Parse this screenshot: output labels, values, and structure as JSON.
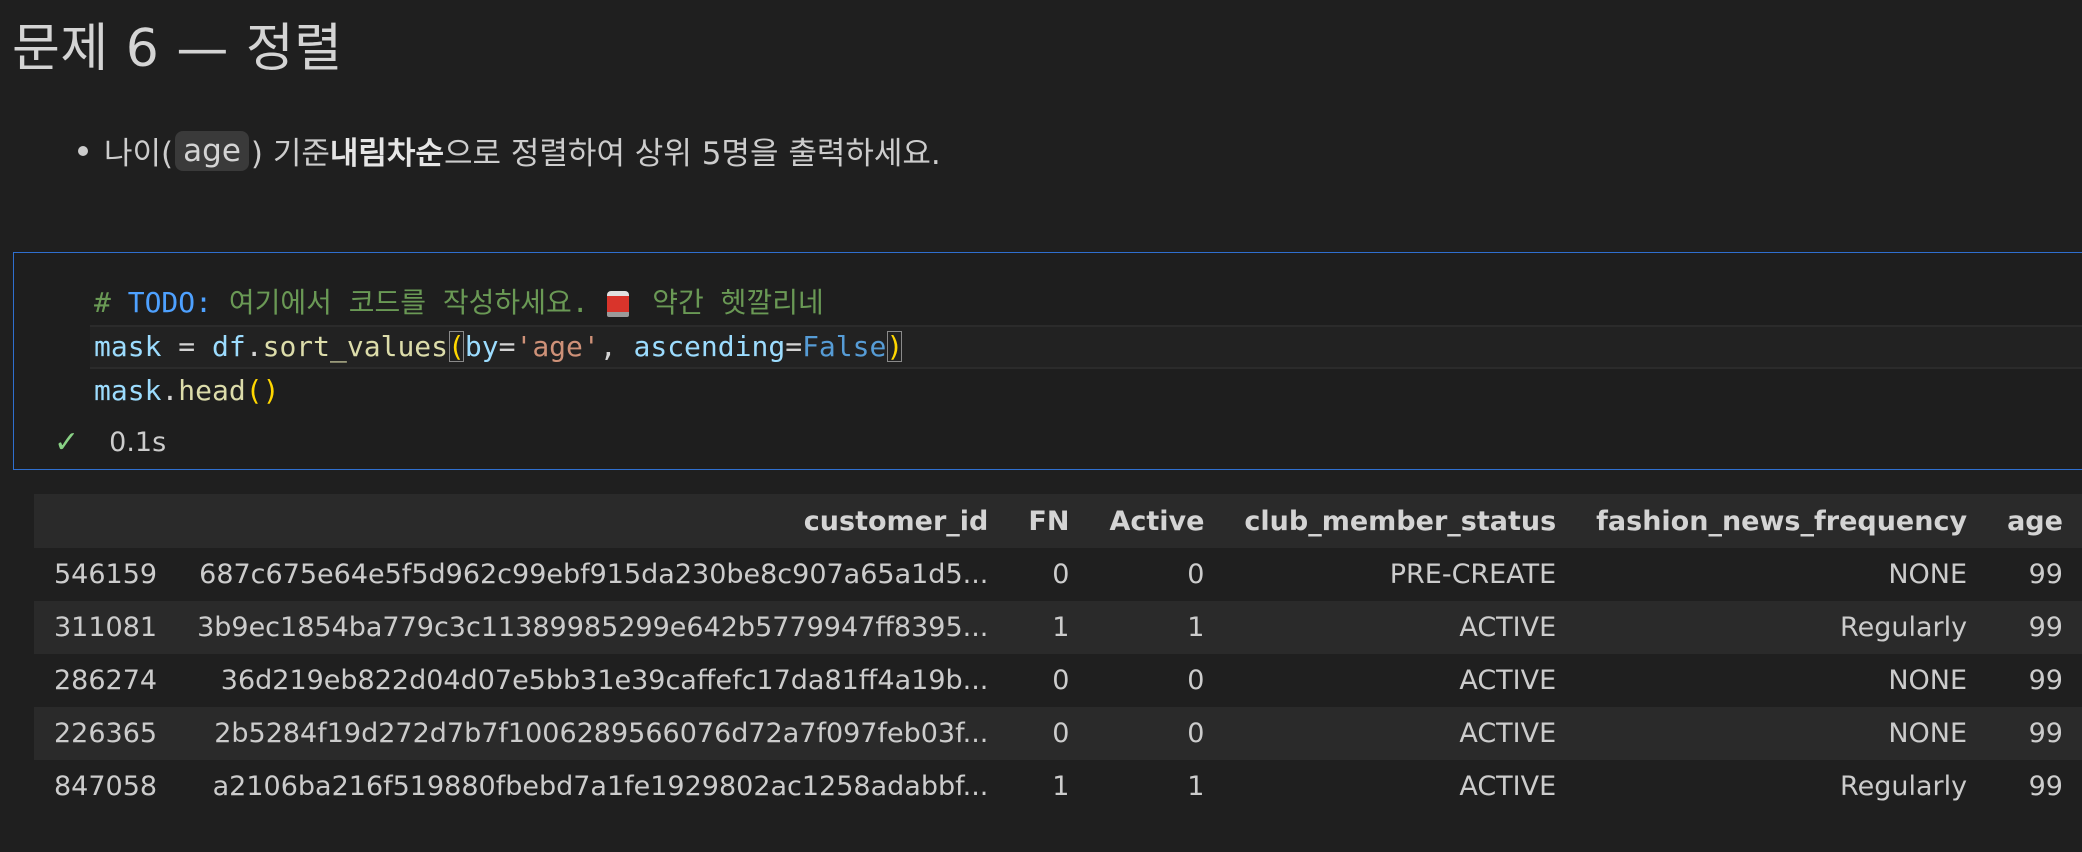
{
  "heading": "문제 6 — 정렬",
  "instruction": {
    "prefix": "나이(",
    "code": "age",
    "middle": ") 기준 ",
    "bold": "내림차순",
    "suffix": "으로 정렬하여 상위 5명을 출력하세요."
  },
  "code": {
    "comment_hash": "# ",
    "comment_todo": "TODO:",
    "comment_text": " 여기에서 코드를 작성하세요. ",
    "comment_tail": " 약간 헷깔리네",
    "line2": {
      "var": "mask",
      "eq": " = ",
      "obj": "df",
      "dot": ".",
      "func": "sort_values",
      "lparen": "(",
      "arg1": "by",
      "eq1": "=",
      "str1": "'age'",
      "comma": ", ",
      "arg2": "ascending",
      "eq2": "=",
      "kw": "False",
      "rparen": ")"
    },
    "line3": {
      "var": "mask",
      "dot": ".",
      "func": "head",
      "parens": "()"
    }
  },
  "execution": {
    "time": "0.1s"
  },
  "table": {
    "columns": [
      "",
      "customer_id",
      "FN",
      "Active",
      "club_member_status",
      "fashion_news_frequency",
      "age"
    ],
    "rows": [
      [
        "546159",
        "687c675e64e5f5d962c99ebf915da230be8c907a65a1d5...",
        "0",
        "0",
        "PRE-CREATE",
        "NONE",
        "99"
      ],
      [
        "311081",
        "3b9ec1854ba779c3c11389985299e642b5779947ff8395...",
        "1",
        "1",
        "ACTIVE",
        "Regularly",
        "99"
      ],
      [
        "286274",
        "36d219eb822d04d07e5bb31e39caffefc17da81ff4a19b...",
        "0",
        "0",
        "ACTIVE",
        "NONE",
        "99"
      ],
      [
        "226365",
        "2b5284f19d272d7b7f1006289566076d72a7f097feb03f...",
        "0",
        "0",
        "ACTIVE",
        "NONE",
        "99"
      ],
      [
        "847058",
        "a2106ba216f519880fbebd7a1fe1929802ac1258adabbf...",
        "1",
        "1",
        "ACTIVE",
        "Regularly",
        "99"
      ]
    ]
  }
}
